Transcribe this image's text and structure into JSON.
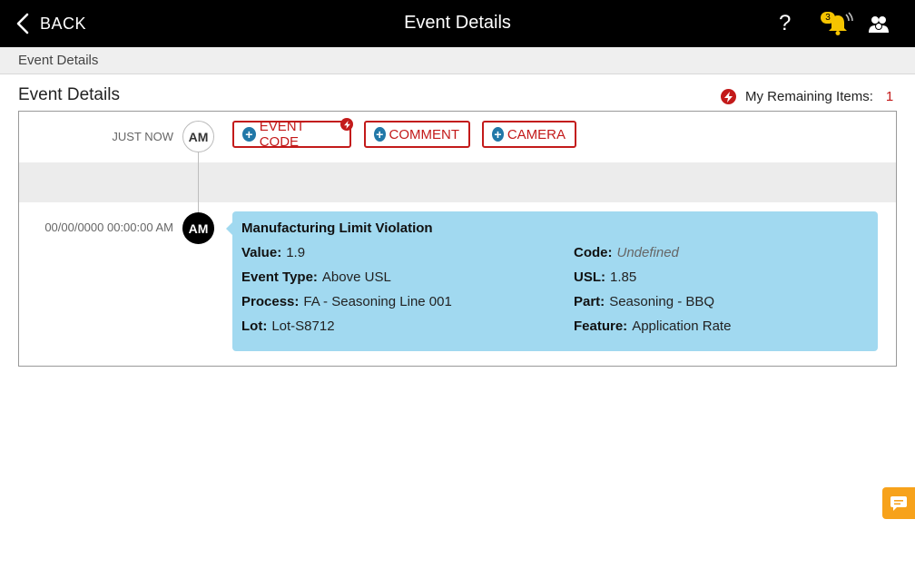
{
  "topbar": {
    "back_label": "BACK",
    "title": "Event Details",
    "help_label": "?",
    "notification_count": "3"
  },
  "breadcrumb": {
    "current": "Event Details"
  },
  "section": {
    "title": "Event Details",
    "remaining_label": "My Remaining Items:",
    "remaining_count": "1"
  },
  "timeline": {
    "new_entry": {
      "time": "JUST NOW",
      "initials": "AM",
      "buttons": {
        "event_code": "EVENT CODE",
        "comment": "COMMENT",
        "camera": "CAMERA"
      }
    },
    "event": {
      "time": "00/00/0000 00:00:00 AM",
      "initials": "AM",
      "title": "Manufacturing Limit Violation",
      "fields": {
        "value": {
          "label": "Value:",
          "value": "1.9"
        },
        "code": {
          "label": "Code:",
          "value": "Undefined"
        },
        "event_type": {
          "label": "Event Type:",
          "value": "Above USL"
        },
        "usl": {
          "label": "USL:",
          "value": "1.85"
        },
        "process": {
          "label": "Process:",
          "value": "FA - Seasoning Line 001"
        },
        "part": {
          "label": "Part:",
          "value": "Seasoning - BBQ"
        },
        "lot": {
          "label": "Lot:",
          "value": "Lot-S8712"
        },
        "feature": {
          "label": "Feature:",
          "value": "Application Rate"
        }
      }
    }
  },
  "colors": {
    "accent_red": "#c31a1a",
    "plus_blue": "#2178a8",
    "card_blue": "#a1d9f0",
    "badge_yellow": "#f5c400",
    "chat_orange": "#f7a21b"
  },
  "icons": {
    "back": "chevron-left-icon",
    "help": "question-icon",
    "notifications": "bell-icon",
    "users": "users-icon",
    "remaining": "lightning-icon",
    "add": "plus-circle-icon",
    "chat": "chat-icon"
  }
}
